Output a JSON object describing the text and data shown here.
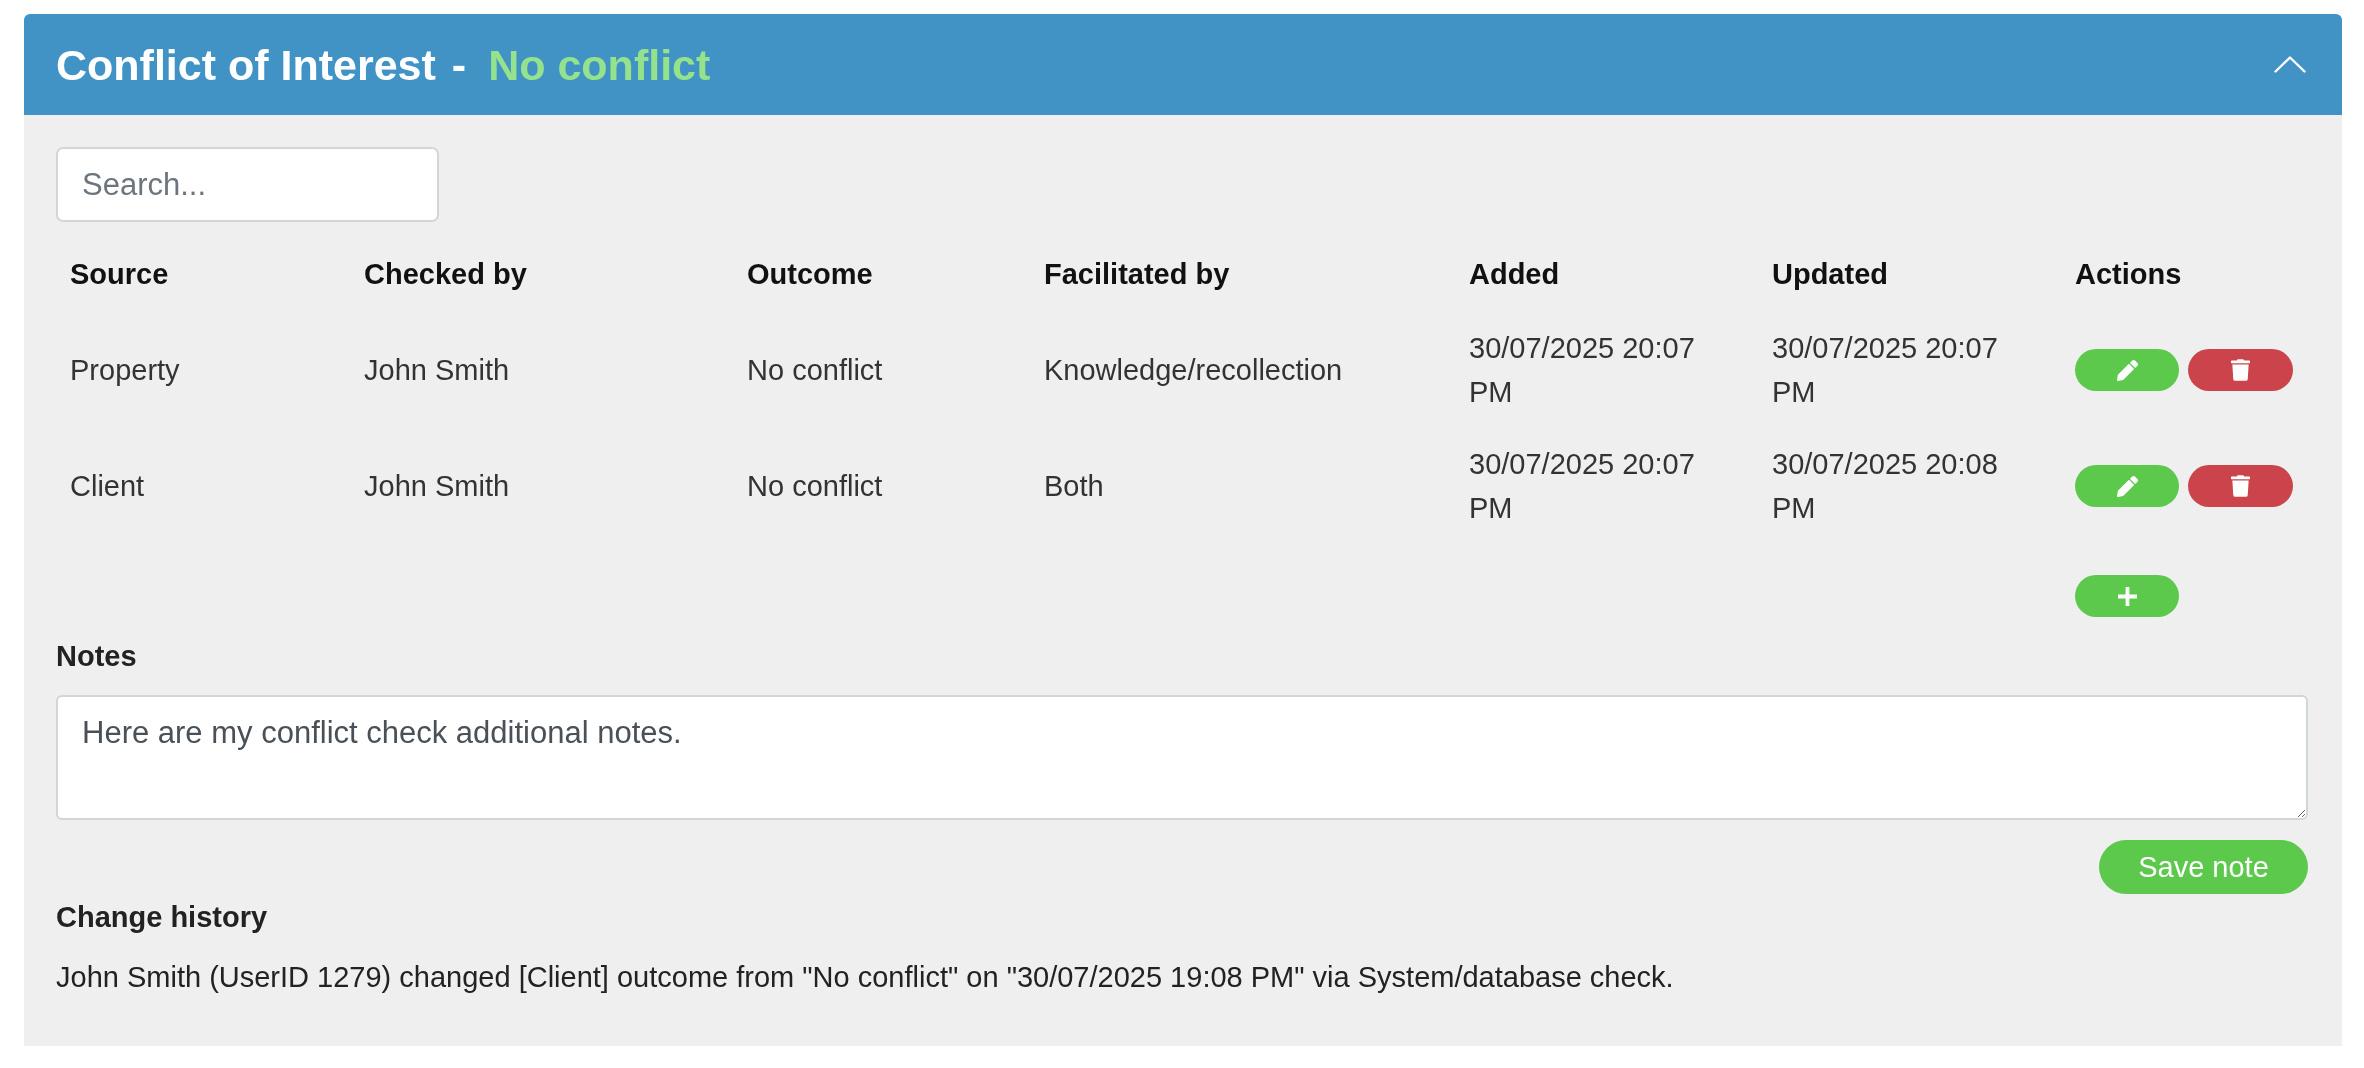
{
  "panel": {
    "title": "Conflict of Interest",
    "separator": "-",
    "status": "No conflict",
    "expanded": true
  },
  "search": {
    "placeholder": "Search..."
  },
  "table": {
    "columns": [
      "Source",
      "Checked by",
      "Outcome",
      "Facilitated by",
      "Added",
      "Updated",
      "Actions"
    ],
    "rows": [
      {
        "source": "Property",
        "checked_by": "John Smith",
        "outcome": "No conflict",
        "facilitated_by": "Knowledge/recollection",
        "added": "30/07/2025 20:07 PM",
        "updated": "30/07/2025 20:07 PM"
      },
      {
        "source": "Client",
        "checked_by": "John Smith",
        "outcome": "No conflict",
        "facilitated_by": "Both",
        "added": "30/07/2025 20:07 PM",
        "updated": "30/07/2025 20:08 PM"
      }
    ]
  },
  "notes": {
    "label": "Notes",
    "value": "Here are my conflict check additional notes.",
    "button": "Save note"
  },
  "change_history": {
    "label": "Change history",
    "entries": [
      "John Smith (UserID 1279) changed [Client] outcome from \"No conflict\" on \"30/07/2025 19:08 PM\" via System/database check."
    ]
  }
}
